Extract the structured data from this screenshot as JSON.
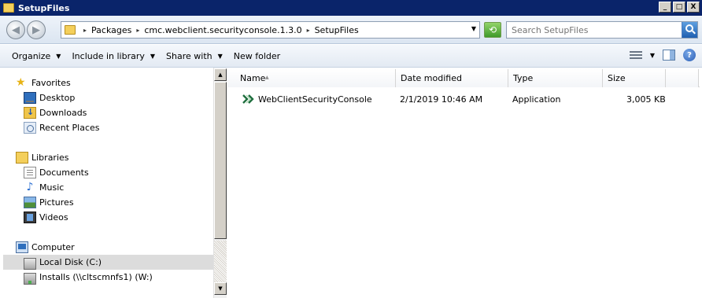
{
  "window": {
    "title": "SetupFiles",
    "controls": {
      "minimize": "_",
      "maximize": "□",
      "close": "X"
    }
  },
  "address": {
    "breadcrumbs": [
      "Packages",
      "cmc.webclient.securityconsole.1.3.0",
      "SetupFiles"
    ],
    "separator": "▸",
    "dropdown": "▼"
  },
  "search": {
    "placeholder": "Search SetupFiles"
  },
  "toolbar": {
    "organize": "Organize",
    "include_in_library": "Include in library",
    "share_with": "Share with",
    "new_folder": "New folder",
    "dropdown_glyph": "▼",
    "help": "?"
  },
  "navigation": {
    "favorites": {
      "label": "Favorites",
      "items": [
        {
          "label": "Desktop",
          "icon": "desktop-icon"
        },
        {
          "label": "Downloads",
          "icon": "downloads-icon"
        },
        {
          "label": "Recent Places",
          "icon": "recent-places-icon"
        }
      ]
    },
    "libraries": {
      "label": "Libraries",
      "items": [
        {
          "label": "Documents",
          "icon": "documents-icon"
        },
        {
          "label": "Music",
          "icon": "music-icon"
        },
        {
          "label": "Pictures",
          "icon": "pictures-icon"
        },
        {
          "label": "Videos",
          "icon": "videos-icon"
        }
      ]
    },
    "computer": {
      "label": "Computer",
      "items": [
        {
          "label": "Local Disk (C:)",
          "icon": "local-disk-icon",
          "selected": true
        },
        {
          "label": "Installs (\\\\cltscmnfs1) (W:)",
          "icon": "network-drive-icon"
        }
      ]
    }
  },
  "columns": {
    "name": "Name",
    "date_modified": "Date modified",
    "type": "Type",
    "size": "Size"
  },
  "files": [
    {
      "name": "WebClientSecurityConsole",
      "date_modified": "2/1/2019 10:46 AM",
      "type": "Application",
      "size": "3,005 KB"
    }
  ]
}
